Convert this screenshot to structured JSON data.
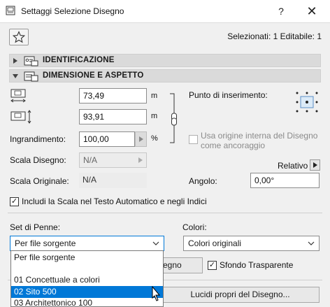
{
  "window": {
    "title": "Settaggi Selezione Disegno",
    "help_label": "?",
    "close_label": "✕"
  },
  "header": {
    "selection_info": "Selezionati: 1 Editabile: 1"
  },
  "sections": {
    "identification": "IDENTIFICAZIONE",
    "dimension": "DIMENSIONE E ASPETTO"
  },
  "dimension": {
    "width_value": "73,49",
    "width_unit": "m",
    "height_value": "93,91",
    "height_unit": "m",
    "magnification_label": "Ingrandimento:",
    "magnification_value": "100,00",
    "magnification_unit": "%",
    "drawing_scale_label": "Scala Disegno:",
    "drawing_scale_value": "N/A",
    "original_scale_label": "Scala Originale:",
    "original_scale_value": "N/A",
    "insertion_point_label": "Punto di inserimento:",
    "use_origin_label_1": "Usa origine interna del Disegno",
    "use_origin_label_2": "come ancoraggio",
    "relative_label": "Relativo",
    "angle_label": "Angolo:",
    "angle_value": "0,00°",
    "include_scale_label": "Includi la Scala nel Testo Automatico e negli Indici",
    "include_scale_checked": "✓"
  },
  "pens": {
    "pen_set_label": "Set di Penne:",
    "pen_set_value": "Per file sorgente",
    "colors_label": "Colori:",
    "colors_value": "Colori originali",
    "pen_button_partial": "egno",
    "transparent_bg_label": "Sfondo Trasparente",
    "transparent_bg_checked": "✓",
    "own_layers_button": "Lucidi propri del Disegno...",
    "options": [
      "Per file sorgente",
      "01 Concettuale a colori",
      "02 Sito 500",
      "03 Architettonico 100"
    ],
    "selected_option": "02 Sito 500"
  },
  "colors": {
    "accent": "#0078d7",
    "section_bg": "#dadada"
  }
}
